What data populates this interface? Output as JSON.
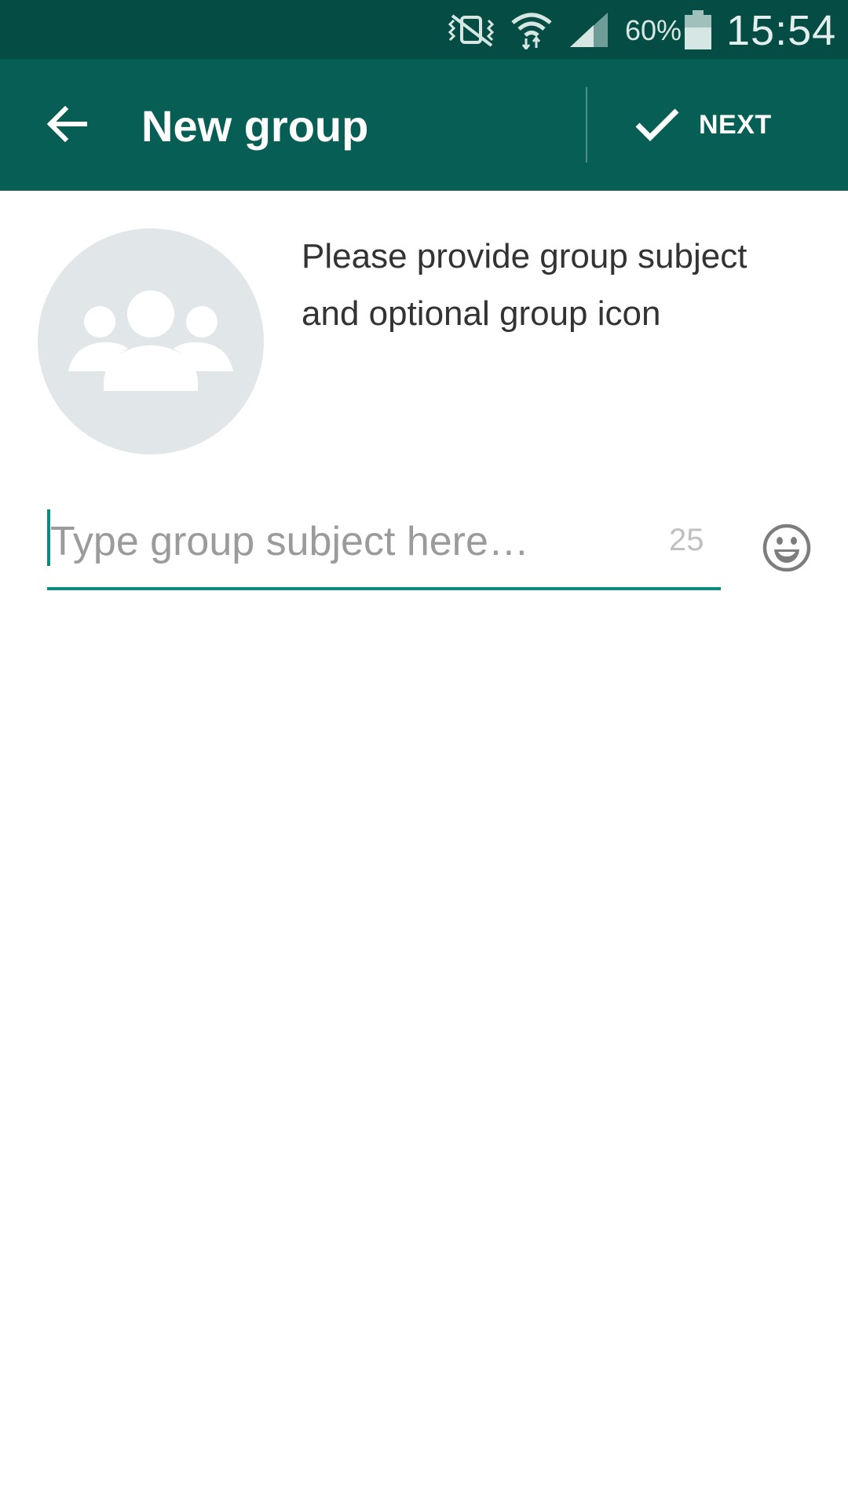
{
  "status_bar": {
    "battery_percent": "60%",
    "time": "15:54",
    "icons": [
      "vibrate-mute-icon",
      "wifi-icon",
      "cell-signal-icon",
      "battery-icon"
    ]
  },
  "app_bar": {
    "title": "New group",
    "back_icon": "arrow-back-icon",
    "next_label": "NEXT",
    "next_icon": "check-icon",
    "background_color": "#075e54",
    "status_bar_color": "#054d44"
  },
  "group_info": {
    "avatar_icon": "group-people-icon",
    "instruction": "Please provide group subject and optional group icon"
  },
  "subject_input": {
    "placeholder": "Type group subject here…",
    "value": "",
    "remaining_chars": "25",
    "emoji_icon": "smiley-emoji-icon",
    "accent_color": "#0e8a7d"
  }
}
